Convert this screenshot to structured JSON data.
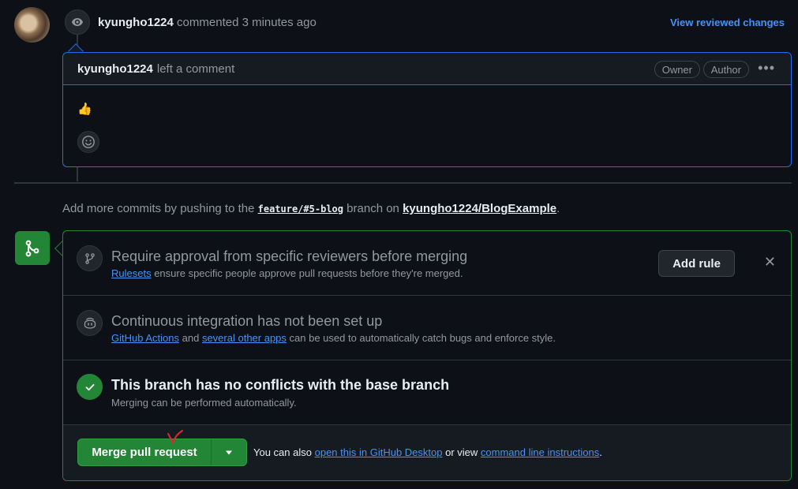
{
  "review": {
    "user": "kyungho1224",
    "action": "commented",
    "time": "3 minutes ago",
    "view_changes": "View reviewed changes"
  },
  "comment": {
    "user": "kyungho1224",
    "action": "left a comment",
    "badges": [
      "Owner",
      "Author"
    ],
    "body": "👍"
  },
  "push": {
    "prefix": "Add more commits by pushing to the",
    "branch": "feature/#5-blog",
    "middle": "branch on",
    "repo": "kyungho1224/BlogExample",
    "suffix": "."
  },
  "checks": {
    "approval": {
      "title": "Require approval from specific reviewers before merging",
      "link": "Rulesets",
      "text": "ensure specific people approve pull requests before they're merged.",
      "button": "Add rule"
    },
    "ci": {
      "title": "Continuous integration has not been set up",
      "link1": "GitHub Actions",
      "and": "and",
      "link2": "several other apps",
      "text": "can be used to automatically catch bugs and enforce style."
    },
    "conflicts": {
      "title": "This branch has no conflicts with the base branch",
      "text": "Merging can be performed automatically."
    }
  },
  "merge": {
    "button": "Merge pull request",
    "alt_prefix": "You can also",
    "link1": "open this in GitHub Desktop",
    "or_view": "or view",
    "link2": "command line instructions",
    "suffix": "."
  },
  "colors": {
    "background": "#0d1117",
    "accent_blue": "#4493f8",
    "success_green": "#238636"
  }
}
